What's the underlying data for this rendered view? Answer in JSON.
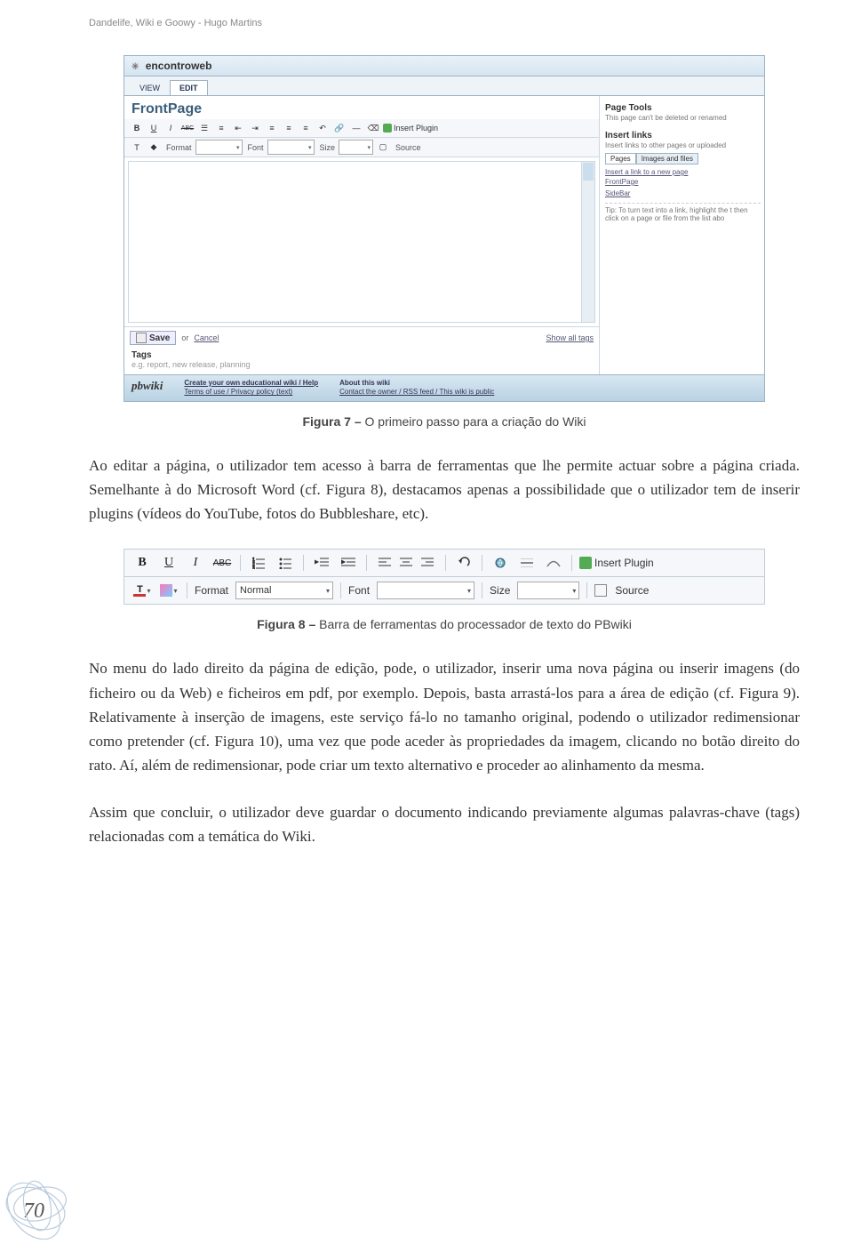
{
  "running_head": "Dandelife, Wiki e Goowy - Hugo Martins",
  "shot1": {
    "window_title": "encontroweb",
    "tabs": {
      "view": "VIEW",
      "edit": "EDIT"
    },
    "page_title": "FrontPage",
    "tb1": {
      "bold": "B",
      "underline": "U",
      "italic": "I",
      "strike": "ABC",
      "insert_plugin": "Insert Plugin"
    },
    "tb2": {
      "format_label": "Format",
      "format_value": "",
      "font_label": "Font",
      "font_value": "",
      "size_label": "Size",
      "size_value": "",
      "source_label": "Source"
    },
    "save": "Save",
    "or": "or",
    "cancel": "Cancel",
    "show_all_tags": "Show all tags",
    "tags_label": "Tags",
    "tags_hint": "e.g. report, new release, planning",
    "footer": {
      "logo": "pbwiki",
      "col1_h": "Create your own educational wiki / Help",
      "col1_s": "Terms of use / Privacy policy (text)",
      "col2_h": "About this wiki",
      "col2_s": "Contact the owner / RSS feed / This wiki is public"
    },
    "side": {
      "page_tools_h": "Page Tools",
      "page_tools_s": "This page can't be deleted or renamed",
      "insert_links_h": "Insert links",
      "insert_links_s": "Insert links to other pages or uploaded",
      "tab_pages": "Pages",
      "tab_images": "Images and files",
      "search_row": "Insert a link to a new page",
      "item1": "FrontPage",
      "item2": "SideBar",
      "tip": "Tip: To turn text into a link, highlight the t\nthen click on a page or file from the list abo"
    }
  },
  "caption1_b": "Figura 7 –",
  "caption1": " O primeiro passo para a criação do Wiki",
  "para1": "Ao editar a página, o utilizador tem acesso à barra de ferramentas que lhe permite actuar sobre a página criada. Semelhante à do Microsoft Word (cf. Figura 8), destacamos apenas a possibilidade que o utilizador tem de inserir plugins (vídeos do YouTube, fotos do Bubbleshare, etc).",
  "shot2": {
    "row1": {
      "bold": "B",
      "underline": "U",
      "italic": "I",
      "strike": "ABC",
      "insert_plugin": "Insert Plugin"
    },
    "row2": {
      "format_label": "Format",
      "format_value": "Normal",
      "font_label": "Font",
      "font_value": "",
      "size_label": "Size",
      "size_value": "",
      "source_label": "Source"
    }
  },
  "caption2_b": "Figura 8 –",
  "caption2": " Barra de ferramentas do processador de texto do PBwiki",
  "para2": "No menu do lado direito da página de edição, pode, o utilizador, inserir uma nova página ou inserir imagens (do ficheiro ou da Web) e ficheiros em pdf, por exemplo. Depois, basta arrastá-los para a área de edição (cf. Figura 9). Relativamente à inserção de imagens, este serviço fá-lo no tamanho original, podendo o utilizador redimensionar como pretender (cf. Figura 10), uma vez que pode aceder às propriedades da imagem, clicando no botão direito do rato. Aí, além de redimensionar, pode criar um texto alternativo e proceder ao alinhamento da mesma.",
  "para3": "Assim que concluir, o utilizador deve guardar o documento indicando previamente algumas palavras-chave (tags) relacionadas com a temática do Wiki.",
  "page_number": "70"
}
